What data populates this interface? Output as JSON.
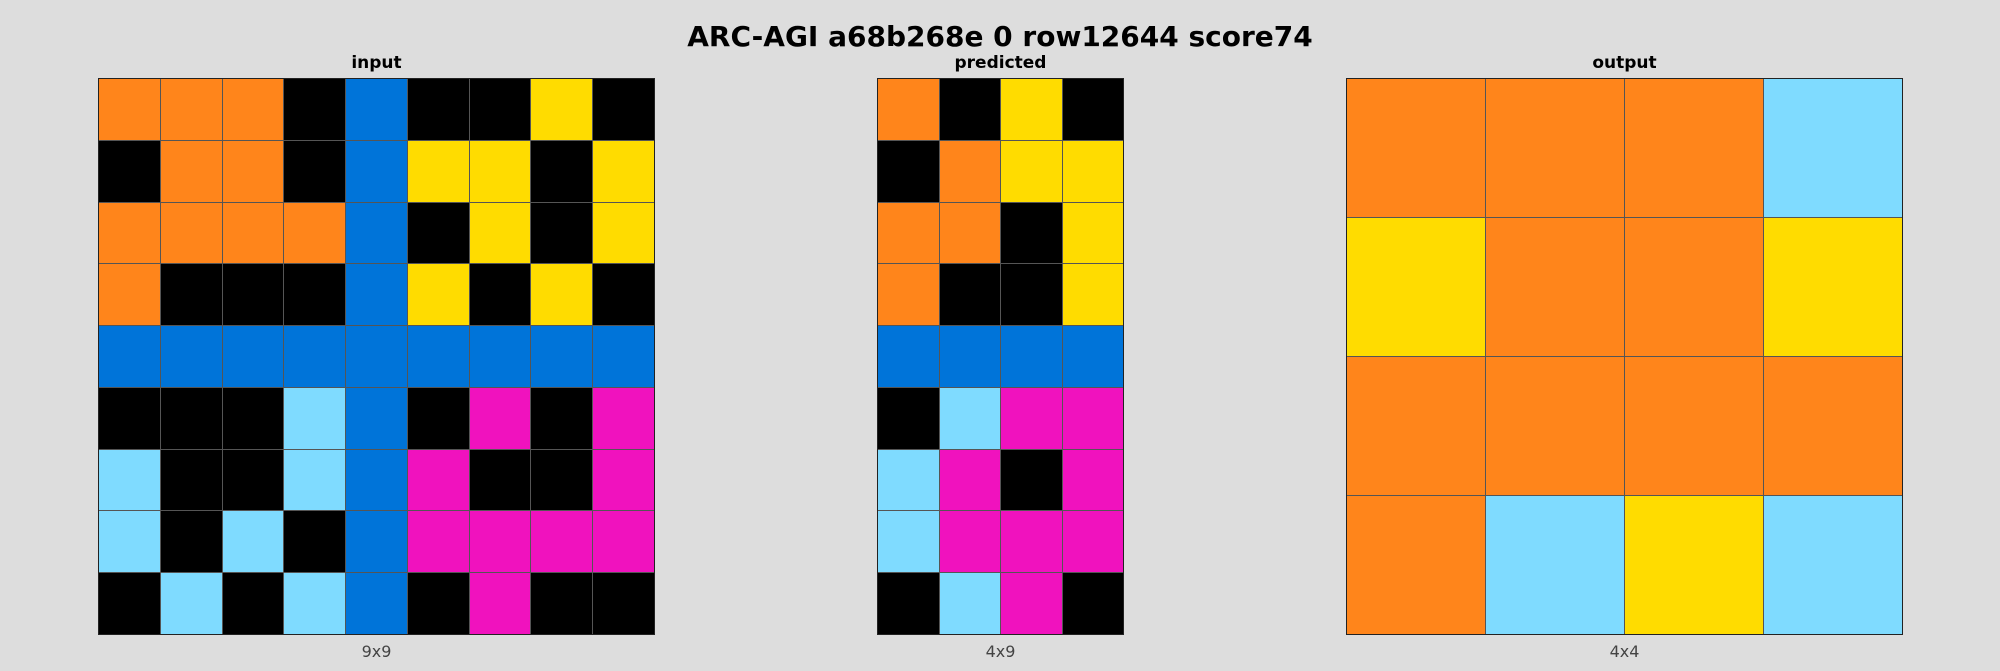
{
  "title": "ARC-AGI a68b268e 0 row12644 score74",
  "palette": {
    "0": "#000000",
    "1": "#0074d9",
    "4": "#ffdc00",
    "6": "#f012be",
    "7": "#ff851b",
    "8": "#7fdbff"
  },
  "panels": [
    {
      "name": "input",
      "label": "input",
      "dims": "9x9",
      "grid": [
        [
          7,
          7,
          7,
          0,
          1,
          0,
          0,
          4,
          0
        ],
        [
          0,
          7,
          7,
          0,
          1,
          4,
          4,
          0,
          4
        ],
        [
          7,
          7,
          7,
          7,
          1,
          0,
          4,
          0,
          4
        ],
        [
          7,
          0,
          0,
          0,
          1,
          4,
          0,
          4,
          0
        ],
        [
          1,
          1,
          1,
          1,
          1,
          1,
          1,
          1,
          1
        ],
        [
          0,
          0,
          0,
          8,
          1,
          0,
          6,
          0,
          6
        ],
        [
          8,
          0,
          0,
          8,
          1,
          6,
          0,
          0,
          6
        ],
        [
          8,
          0,
          8,
          0,
          1,
          6,
          6,
          6,
          6
        ],
        [
          0,
          8,
          0,
          8,
          1,
          0,
          6,
          0,
          0
        ]
      ]
    },
    {
      "name": "predicted",
      "label": "predicted",
      "dims": "4x9",
      "grid": [
        [
          7,
          0,
          4,
          0
        ],
        [
          0,
          7,
          4,
          4
        ],
        [
          7,
          7,
          0,
          4
        ],
        [
          7,
          0,
          0,
          4
        ],
        [
          1,
          1,
          1,
          1
        ],
        [
          0,
          8,
          6,
          6
        ],
        [
          8,
          6,
          0,
          6
        ],
        [
          8,
          6,
          6,
          6
        ],
        [
          0,
          8,
          6,
          0
        ]
      ]
    },
    {
      "name": "output",
      "label": "output",
      "dims": "4x4",
      "grid": [
        [
          7,
          7,
          7,
          8
        ],
        [
          4,
          7,
          7,
          4
        ],
        [
          7,
          7,
          7,
          7
        ],
        [
          7,
          8,
          4,
          8
        ]
      ]
    }
  ]
}
